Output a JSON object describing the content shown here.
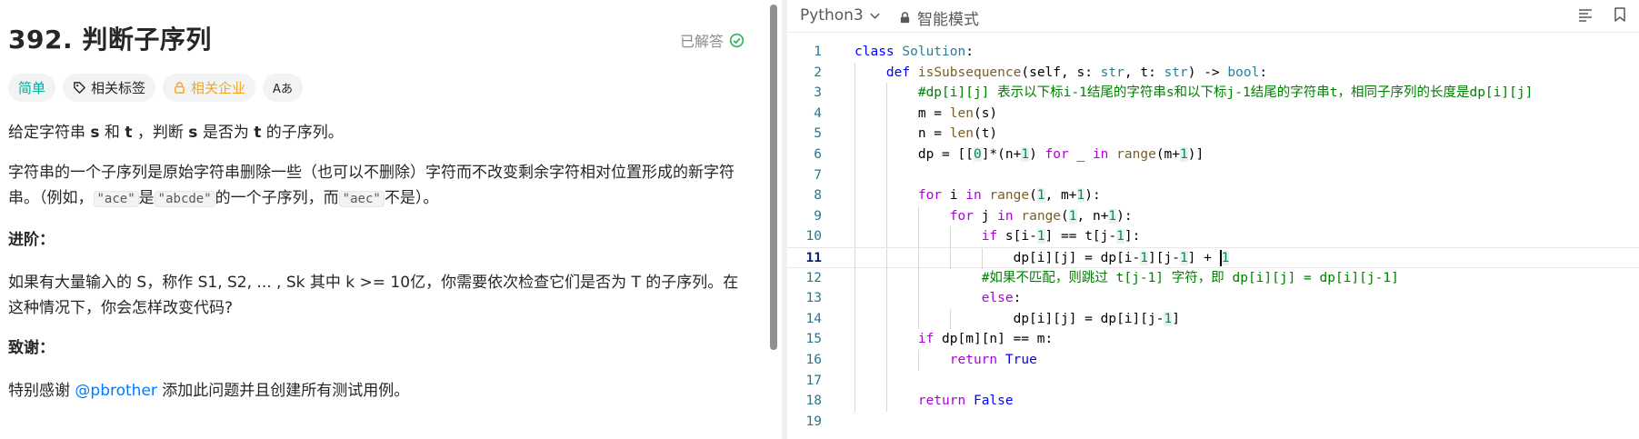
{
  "problem": {
    "title": "392. 判断子序列",
    "status": "已解答",
    "tags": {
      "difficulty": "简单",
      "related_tags": "相关标签",
      "related_companies": "相关企业",
      "translate": "Aあ"
    },
    "paragraph1_prefix": "给定字符串 ",
    "s_bold": "s",
    "paragraph1_and": " 和 ",
    "t_bold": "t",
    "paragraph1_mid": " ，判断 ",
    "paragraph1_is": " 是否为 ",
    "paragraph1_end": " 的子序列。",
    "paragraph2_a": "字符串的一个子序列是原始字符串删除一些（也可以不删除）字符而不改变剩余字符相对位置形成的新字符串。（例如，",
    "example_ace": "\"ace\"",
    "paragraph2_b": "是",
    "example_abcde": "\"abcde\"",
    "paragraph2_c": "的一个子序列，而",
    "example_aec": "\"aec\"",
    "paragraph2_d": "不是）。",
    "advanced_heading": "进阶：",
    "advanced_text": "如果有大量输入的 S，称作 S1, S2, ... , Sk 其中 k >= 10亿，你需要依次检查它们是否为 T 的子序列。在这种情况下，你会怎样改变代码?",
    "thanks_heading": "致谢：",
    "thanks_prefix": "特别感谢 ",
    "thanks_link": "@pbrother",
    "thanks_suffix": " 添加此问题并且创建所有测试用例。"
  },
  "editor": {
    "language": "Python3",
    "mode": "智能模式",
    "active_line": 11
  }
}
